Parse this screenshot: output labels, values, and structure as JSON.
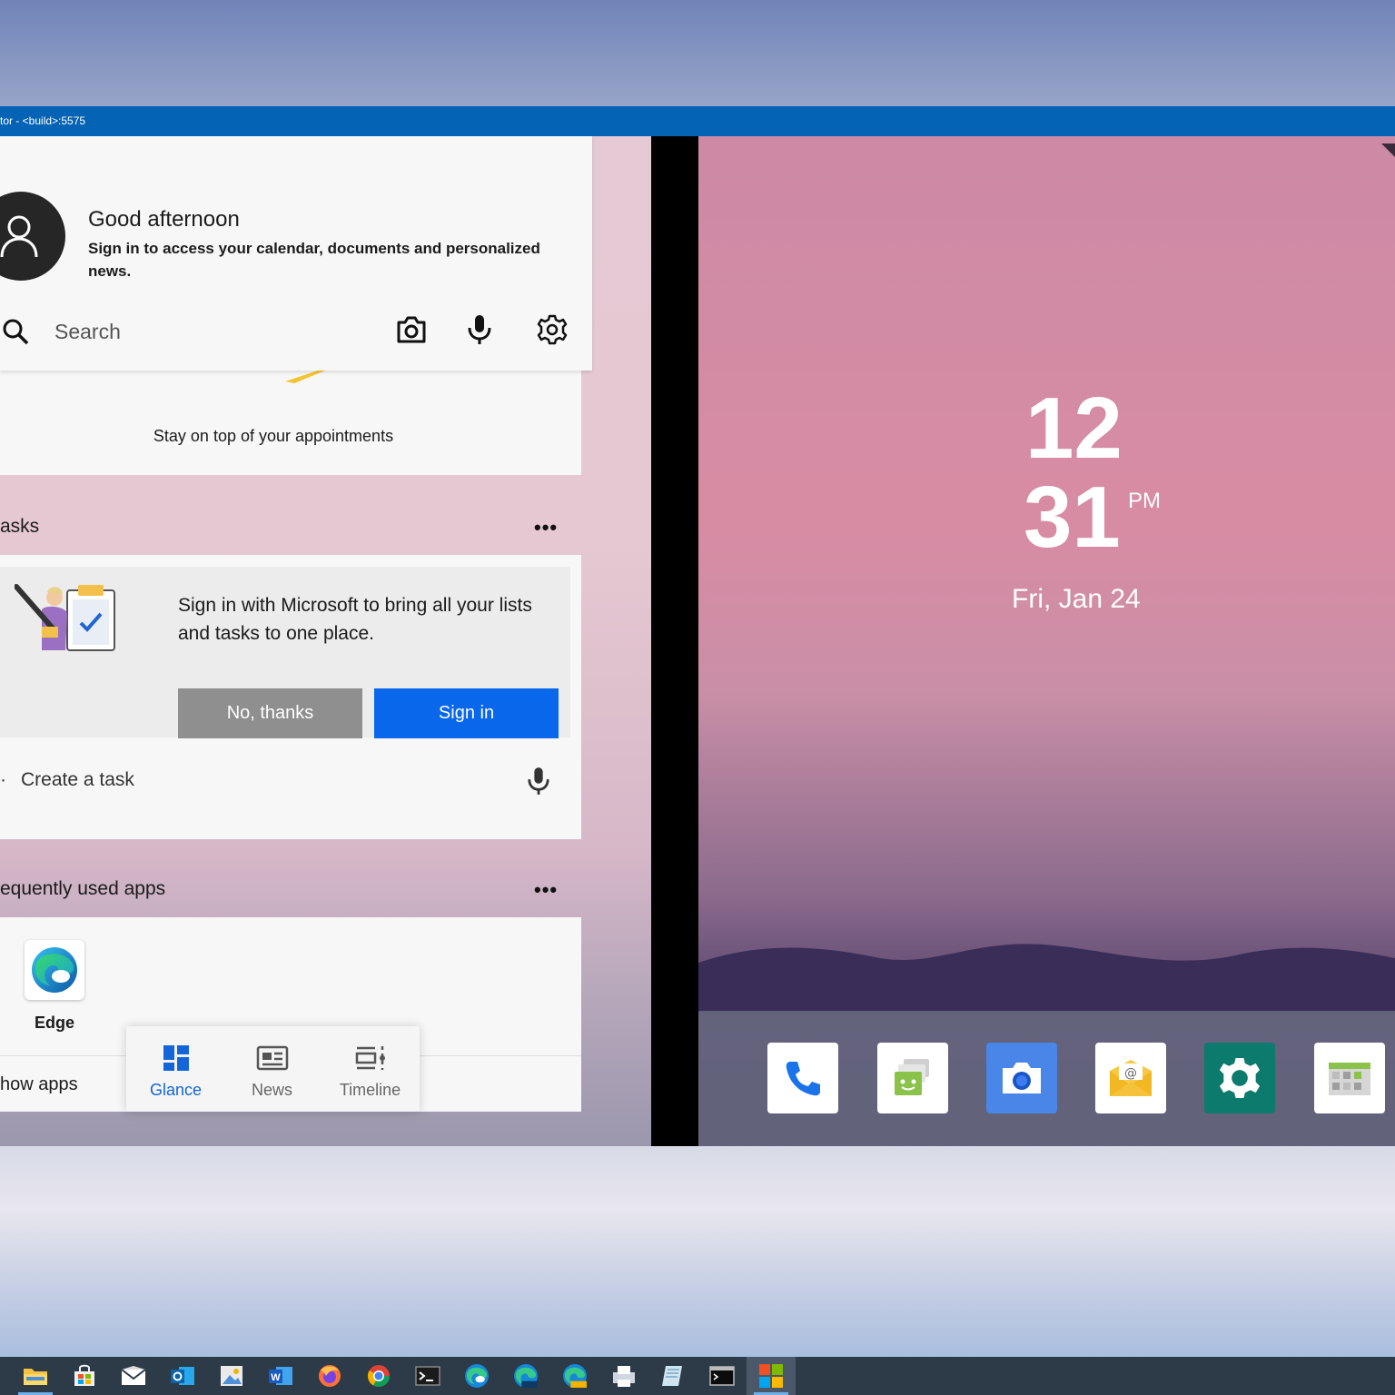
{
  "window": {
    "title": "tor - <build>:5575"
  },
  "header": {
    "greeting": "Good afternoon",
    "signin_prompt": "Sign in to access your calendar, documents and personalized news.",
    "search_placeholder": "Search"
  },
  "calendar": {
    "message": "Stay on top of your appointments"
  },
  "tasks": {
    "heading": "asks",
    "more": "•••",
    "message": "Sign in with Microsoft to bring all your lists and tasks to one place.",
    "no_thanks_label": "No, thanks",
    "sign_in_label": "Sign in",
    "create_bullet": "·",
    "create_label": "Create a task"
  },
  "apps": {
    "heading": "equently used apps",
    "more": "•••",
    "items": [
      {
        "label": "Edge",
        "icon": "edge-icon"
      }
    ],
    "show_apps_label": "how apps"
  },
  "bottom_nav": [
    {
      "label": "Glance",
      "icon": "glance-icon",
      "active": true
    },
    {
      "label": "News",
      "icon": "news-icon",
      "active": false
    },
    {
      "label": "Timeline",
      "icon": "timeline-icon",
      "active": false
    }
  ],
  "clock": {
    "hour": "12",
    "minute": "31",
    "ampm": "PM",
    "date": "Fri, Jan 24"
  },
  "dock": [
    {
      "icon": "phone-icon",
      "color": "#ffffff"
    },
    {
      "icon": "messages-icon",
      "color": "#ffffff"
    },
    {
      "icon": "camera-icon",
      "color": "#4a86e8"
    },
    {
      "icon": "email-icon",
      "color": "#ffffff"
    },
    {
      "icon": "settings-icon",
      "color": "#0c7a6c"
    },
    {
      "icon": "gallery-icon",
      "color": "#ffffff"
    }
  ],
  "taskbar": [
    "file-explorer-icon",
    "store-icon",
    "mail-icon",
    "outlook-icon",
    "photos-icon",
    "word-icon",
    "firefox-icon",
    "chrome-icon",
    "terminal-icon",
    "edge-icon",
    "edge-beta-icon",
    "edge-canary-icon",
    "printer-icon",
    "notepad-icon",
    "command-prompt-icon",
    "emulator-icon"
  ],
  "colors": {
    "title_bar": "#0563b5",
    "accent": "#0867ea",
    "nav_active": "#1565d8"
  }
}
